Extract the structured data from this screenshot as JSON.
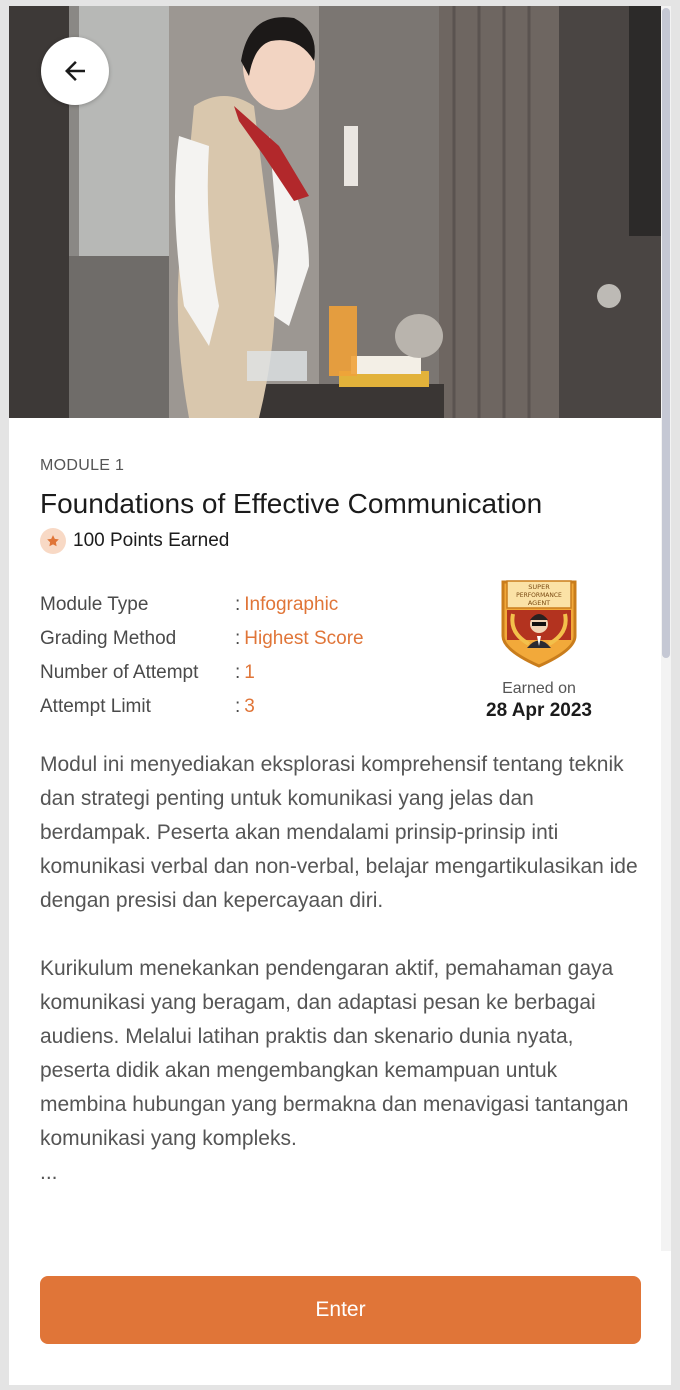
{
  "hero": {
    "image_alt": "Flight attendant serving drinks"
  },
  "header": {
    "back_icon": "arrow-left-icon"
  },
  "module": {
    "label": "MODULE 1",
    "title": "Foundations of Effective Communication",
    "points_text": "100 Points Earned",
    "points_icon": "star-icon"
  },
  "info": {
    "rows": [
      {
        "label": "Module Type",
        "sep": ":",
        "value": "Infographic"
      },
      {
        "label": "Grading Method",
        "sep": ":",
        "value": "Highest Score"
      },
      {
        "label": "Number of Attempt",
        "sep": ":",
        "value": "1"
      },
      {
        "label": "Attempt Limit",
        "sep": ":",
        "value": "3"
      }
    ]
  },
  "badge": {
    "line1": "SUPER",
    "line2": "PERFORMANCE",
    "line3": "AGENT",
    "earned_on_label": "Earned on",
    "earned_date": "28 Apr 2023"
  },
  "description": {
    "paragraphs": [
      "Modul ini menyediakan eksplorasi komprehensif tentang teknik dan strategi penting untuk komunikasi yang jelas dan berdampak. Peserta akan mendalami prinsip-prinsip inti komunikasi verbal dan non-verbal, belajar mengartikulasikan ide dengan presisi dan kepercayaan diri.",
      "Kurikulum menekankan pendengaran aktif, pemahaman gaya komunikasi yang beragam, dan adaptasi pesan ke berbagai audiens. Melalui latihan praktis dan skenario dunia nyata, peserta didik akan mengembangkan kemampuan untuk membina hubungan yang bermakna dan menavigasi tantangan komunikasi yang kompleks.",
      "..."
    ]
  },
  "actions": {
    "enter_label": "Enter"
  },
  "colors": {
    "accent": "#e07538",
    "text": "#1b1b1b",
    "muted": "#555555",
    "star_bg": "#f8d9c5"
  }
}
